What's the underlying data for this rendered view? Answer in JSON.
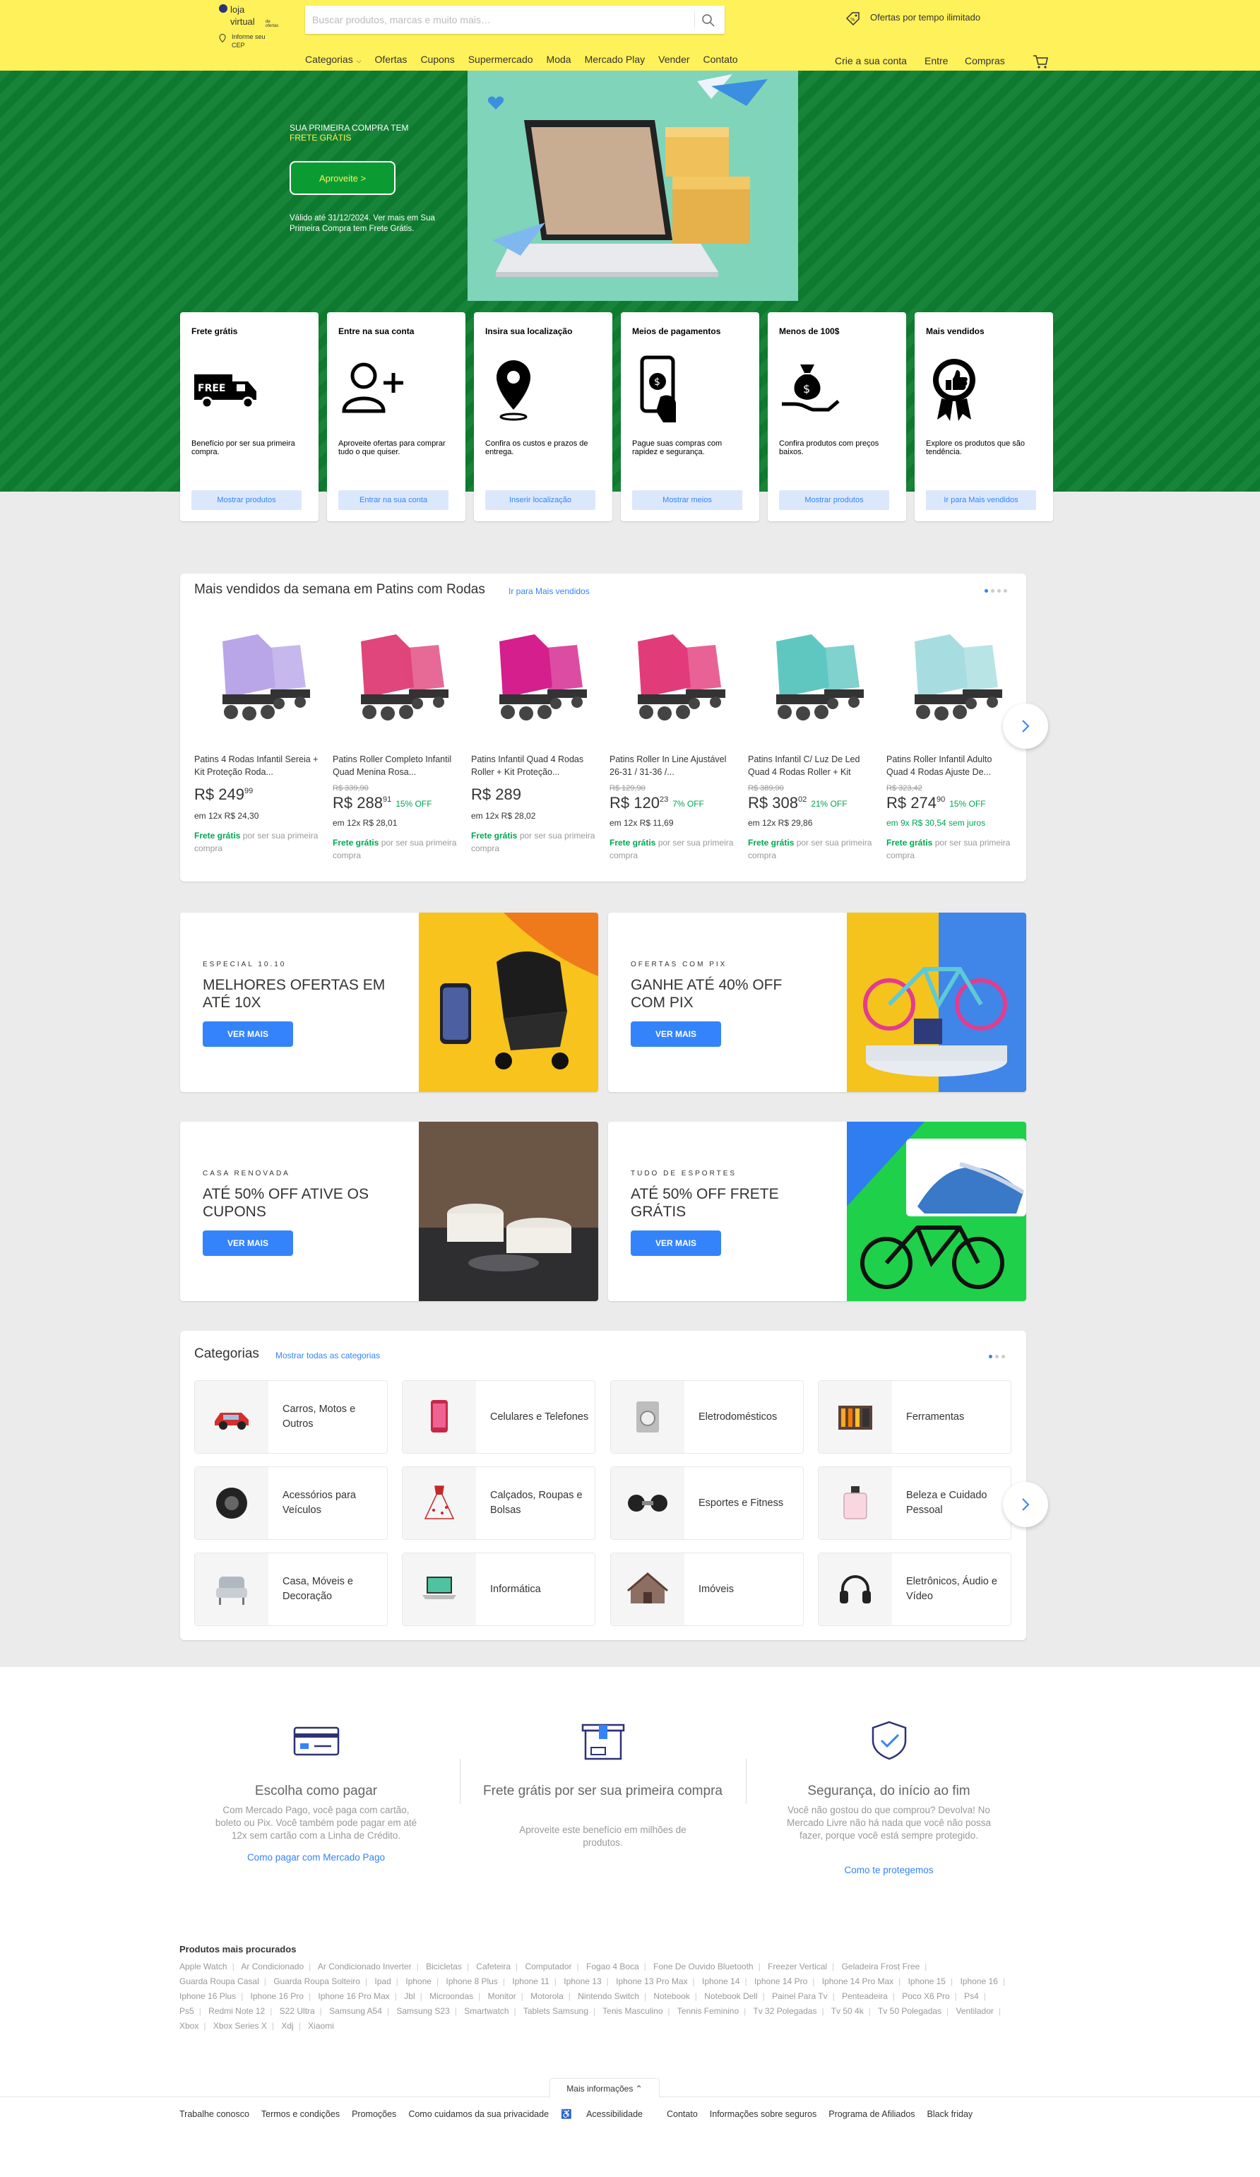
{
  "header": {
    "logo_line1": "loja",
    "logo_line2": "virtual",
    "logo_sub": "de ofertas",
    "cep_line1": "Informe seu",
    "cep_line2": "CEP",
    "search_placeholder": "Buscar produtos, marcas e muito mais…",
    "promo_text": "Ofertas por tempo ilimitado",
    "nav": [
      "Categorias",
      "Ofertas",
      "Cupons",
      "Supermercado",
      "Moda",
      "Mercado Play",
      "Vender",
      "Contato"
    ],
    "right_nav": {
      "create": "Crie a sua conta",
      "login": "Entre",
      "purchases": "Compras"
    },
    "colors": {
      "header_bg": "#fff159",
      "accent": "#3483fa"
    }
  },
  "hero": {
    "kicker": "SUA PRIMEIRA COMPRA TEM",
    "kicker_highlight": "FRETE GRÁTIS",
    "button": "Aproveite >",
    "legal": "Válido até 31/12/2024. Ver mais em Sua Primeira Compra tem Frete Grátis."
  },
  "features": [
    {
      "title": "Frete grátis",
      "desc": "Benefício por ser sua primeira compra.",
      "button": "Mostrar produtos",
      "icon": "free-truck-icon"
    },
    {
      "title": "Entre na sua conta",
      "desc": "Aproveite ofertas para comprar tudo o que quiser.",
      "button": "Entrar na sua conta",
      "icon": "add-user-icon"
    },
    {
      "title": "Insira sua localização",
      "desc": "Confira os custos e prazos de entrega.",
      "button": "Inserir localização",
      "icon": "location-pin-icon"
    },
    {
      "title": "Meios de pagamentos",
      "desc": "Pague suas compras com rapidez e segurança.",
      "button": "Mostrar meios",
      "icon": "phone-payment-icon"
    },
    {
      "title": "Menos de 100$",
      "desc": "Confira produtos com preços baixos.",
      "button": "Mostrar produtos",
      "icon": "money-bag-icon"
    },
    {
      "title": "Mais vendidos",
      "desc": "Explore os produtos que são tendência.",
      "button": "Ir para Mais vendidos",
      "icon": "badge-thumb-icon"
    }
  ],
  "bestsellers": {
    "title": "Mais vendidos da semana em Patins com Rodas",
    "link": "Ir para Mais vendidos",
    "products": [
      {
        "name": "Patins 4 Rodas Infantil Sereia + Kit Proteção Roda...",
        "old": "",
        "price": "R$ 249",
        "cents": "99",
        "off": "",
        "inst": "em 12x R$ 24,30",
        "inst_green": false,
        "ship": "Frete grátis",
        "ship_rest": " por ser sua primeira compra",
        "color": "#b8a6e8"
      },
      {
        "name": "Patins Roller Completo Infantil Quad Menina Rosa...",
        "old": "R$ 339,90",
        "price": "R$ 288",
        "cents": "91",
        "off": "15% OFF",
        "inst": "em 12x R$ 28,01",
        "inst_green": false,
        "ship": "Frete grátis",
        "ship_rest": " por ser sua primeira compra",
        "color": "#e0457b"
      },
      {
        "name": "Patins Infantil Quad 4 Rodas Roller + Kit Proteção...",
        "old": "",
        "price": "R$ 289",
        "cents": "",
        "off": "",
        "inst": "em 12x R$ 28,02",
        "inst_green": false,
        "ship": "Frete grátis",
        "ship_rest": " por ser sua primeira compra",
        "color": "#d41f8c"
      },
      {
        "name": "Patins Roller In Line Ajustável 26-31 / 31-36 /...",
        "old": "R$ 129,90",
        "price": "R$ 120",
        "cents": "23",
        "off": "7% OFF",
        "inst": "em 12x R$ 11,69",
        "inst_green": false,
        "ship": "Frete grátis",
        "ship_rest": " por ser sua primeira compra",
        "color": "#e23b7a"
      },
      {
        "name": "Patins Infantil C/ Luz De Led Quad 4 Rodas Roller + Kit",
        "old": "R$ 389,90",
        "price": "R$ 308",
        "cents": "02",
        "off": "21% OFF",
        "inst": "em 12x R$ 29,86",
        "inst_green": false,
        "ship": "Frete grátis",
        "ship_rest": " por ser sua primeira compra",
        "color": "#5fc7c0"
      },
      {
        "name": "Patins Roller Infantil Adulto Quad 4 Rodas Ajuste De...",
        "old": "R$ 323,42",
        "price": "R$ 274",
        "cents": "90",
        "off": "15% OFF",
        "inst": "em 9x R$ 30,54 sem juros",
        "inst_green": true,
        "ship": "Frete grátis",
        "ship_rest": " por ser sua primeira compra",
        "color": "#a7dde0"
      }
    ]
  },
  "banners": [
    {
      "kicker": "ESPECIAL 10.10",
      "title": "MELHORES OFERTAS EM ATÉ 10X",
      "button": "VER MAIS"
    },
    {
      "kicker": "OFERTAS COM PIX",
      "title": "GANHE ATÉ 40% OFF COM PIX",
      "button": "VER MAIS"
    },
    {
      "kicker": "CASA RENOVADA",
      "title": "ATÉ 50% OFF ATIVE OS CUPONS",
      "button": "VER MAIS"
    },
    {
      "kicker": "TUDO DE ESPORTES",
      "title": "ATÉ 50% OFF FRETE GRÁTIS",
      "button": "VER MAIS"
    }
  ],
  "categories": {
    "title": "Categorias",
    "link": "Mostrar todas as categorias",
    "items": [
      {
        "name": "Carros, Motos e Outros",
        "icon": "car-icon"
      },
      {
        "name": "Celulares e Telefones",
        "icon": "phone-icon"
      },
      {
        "name": "Eletrodomésticos",
        "icon": "washer-icon"
      },
      {
        "name": "Ferramentas",
        "icon": "toolbox-icon"
      },
      {
        "name": "Acessórios para Veículos",
        "icon": "tire-icon"
      },
      {
        "name": "Calçados, Roupas e Bolsas",
        "icon": "dress-icon"
      },
      {
        "name": "Esportes e Fitness",
        "icon": "dumbbell-icon"
      },
      {
        "name": "Beleza e Cuidado Pessoal",
        "icon": "perfume-icon"
      },
      {
        "name": "Casa, Móveis e Decoração",
        "icon": "armchair-icon"
      },
      {
        "name": "Informática",
        "icon": "laptop-icon"
      },
      {
        "name": "Imóveis",
        "icon": "house-icon"
      },
      {
        "name": "Eletrônicos, Áudio e Vídeo",
        "icon": "headphones-icon"
      }
    ]
  },
  "info": [
    {
      "title": "Escolha como pagar",
      "desc": "Com Mercado Pago, você paga com cartão, boleto ou Pix. Você também pode pagar em até 12x sem cartão com a Linha de Crédito.",
      "link": "Como pagar com Mercado Pago",
      "icon": "card-icon"
    },
    {
      "title": "Frete grátis por ser sua primeira compra",
      "desc": "Aproveite este benefício em milhões de produtos.",
      "link": "",
      "icon": "box-icon"
    },
    {
      "title": "Segurança, do início ao fim",
      "desc": "Você não gostou do que comprou? Devolva! No Mercado Livre não há nada que você não possa fazer, porque você está sempre protegido.",
      "link": "Como te protegemos",
      "icon": "shield-check-icon"
    }
  ],
  "footer": {
    "popular_title": "Produtos mais procurados",
    "popular": [
      "Apple Watch",
      "Ar Condicionado",
      "Ar Condicionado Inverter",
      "Bicicletas",
      "Cafeteira",
      "Computador",
      "Fogao 4 Boca",
      "Fone De Ouvido Bluetooth",
      "Freezer Vertical",
      "Geladeira Frost Free",
      "Guarda Roupa Casal",
      "Guarda Roupa Solteiro",
      "Ipad",
      "Iphone",
      "Iphone 8 Plus",
      "Iphone 11",
      "Iphone 13",
      "Iphone 13 Pro Max",
      "Iphone 14",
      "Iphone 14 Pro",
      "Iphone 14 Pro Max",
      "Iphone 15",
      "Iphone 16",
      "Iphone 16 Plus",
      "Iphone 16 Pro",
      "Iphone 16 Pro Max",
      "Jbl",
      "Microondas",
      "Monitor",
      "Motorola",
      "Nintendo Switch",
      "Notebook",
      "Notebook Dell",
      "Painel Para Tv",
      "Penteadeira",
      "Poco X6 Pro",
      "Ps4",
      "Ps5",
      "Redmi Note 12",
      "S22 Ultra",
      "Samsung A54",
      "Samsung S23",
      "Smartwatch",
      "Tablets Samsung",
      "Tenis Masculino",
      "Tennis Feminino",
      "Tv 32 Polegadas",
      "Tv 50 4k",
      "Tv 50 Polegadas",
      "Ventilador",
      "Xbox",
      "Xbox Series X",
      "Xdj",
      "Xiaomi"
    ],
    "more": "Mais informações",
    "links": [
      "Trabalhe conosco",
      "Termos e condições",
      "Promoções",
      "Como cuidamos da sua privacidade",
      "Acessibilidade",
      "Contato",
      "Informações sobre seguros",
      "Programa de Afiliados",
      "Black friday"
    ]
  }
}
